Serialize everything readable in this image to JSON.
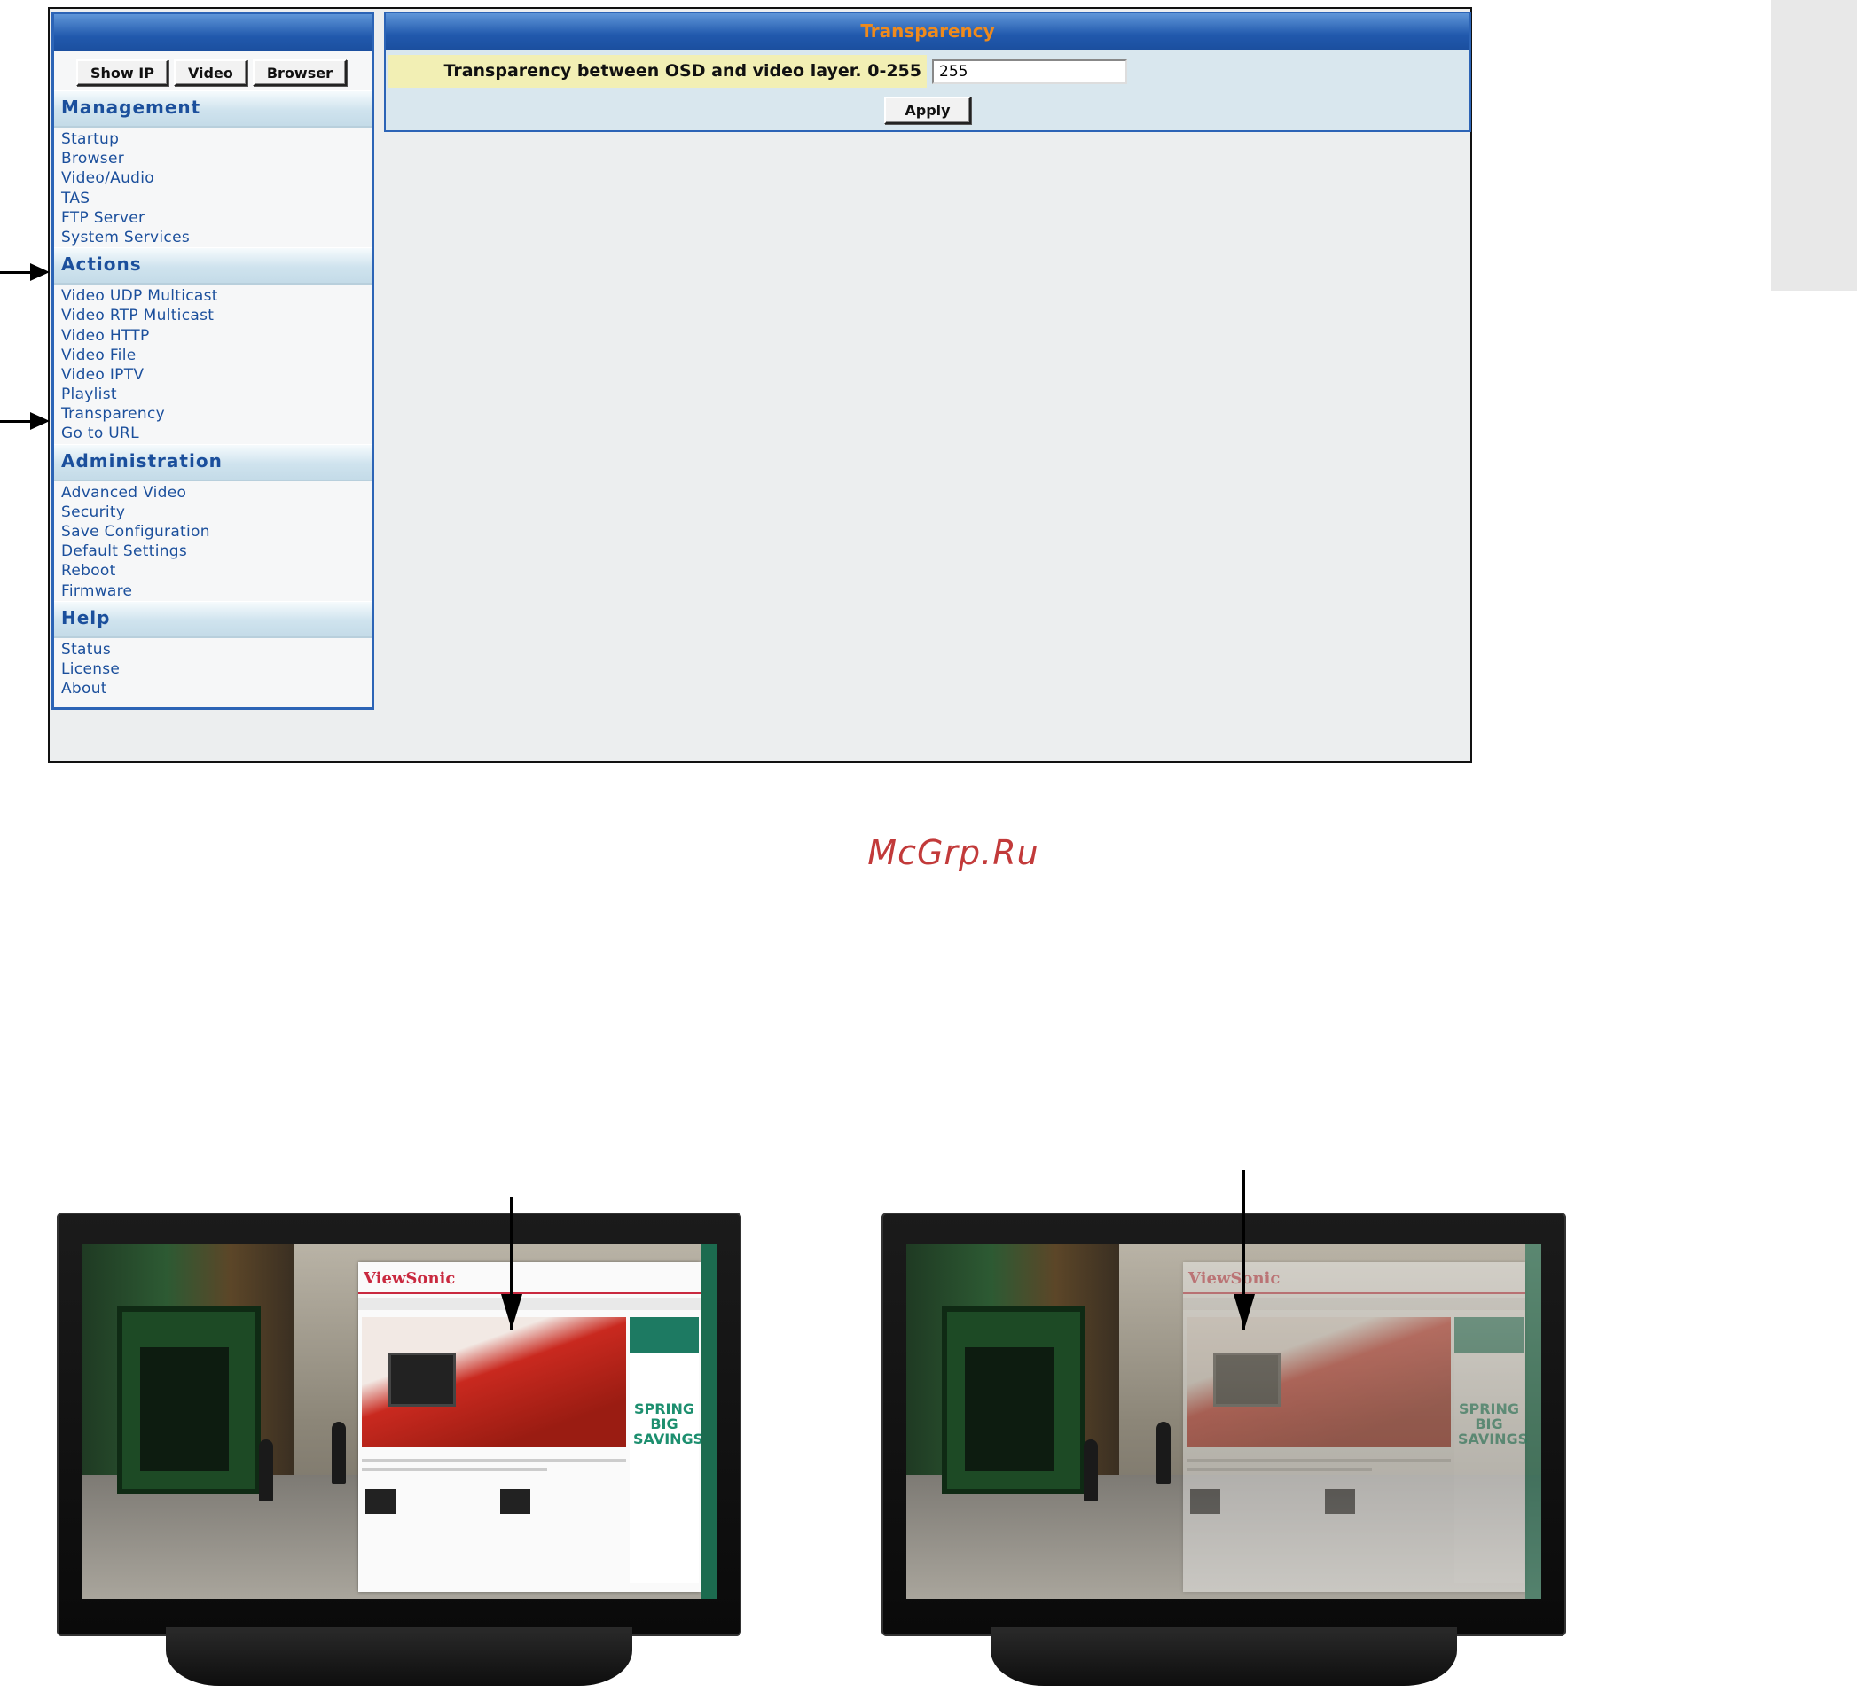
{
  "toolbar": {
    "show_ip": "Show IP",
    "video": "Video",
    "browser": "Browser"
  },
  "sidebar": {
    "sections": [
      {
        "title": "Management",
        "items": [
          "Startup",
          "Browser",
          "Video/Audio",
          "TAS",
          "FTP Server",
          "System Services"
        ]
      },
      {
        "title": "Actions",
        "items": [
          "Video UDP Multicast",
          "Video RTP Multicast",
          "Video HTTP",
          "Video File",
          "Video IPTV",
          "Playlist",
          "Transparency",
          "Go to URL"
        ]
      },
      {
        "title": "Administration",
        "items": [
          "Advanced Video",
          "Security",
          "Save Configuration",
          "Default Settings",
          "Reboot",
          "Firmware"
        ]
      },
      {
        "title": "Help",
        "items": [
          "Status",
          "License",
          "About"
        ]
      }
    ]
  },
  "main": {
    "title": "Transparency",
    "field_label": "Transparency between OSD and video layer. 0-255",
    "field_value": "255",
    "apply_label": "Apply"
  },
  "watermark": "McGrp.Ru",
  "colors": {
    "header_blue": "#2159ad",
    "title_orange": "#ef8a1c",
    "link_blue": "#1b4f9c",
    "label_bg": "#f2efb4",
    "watermark_red": "#c23a3a"
  },
  "illustration": {
    "left_osd_opacity": 1.0,
    "right_osd_opacity": 0.42
  },
  "icons": [
    "arrow-right-icon",
    "arrow-right-icon",
    "arrow-down-icon",
    "arrow-down-icon"
  ]
}
